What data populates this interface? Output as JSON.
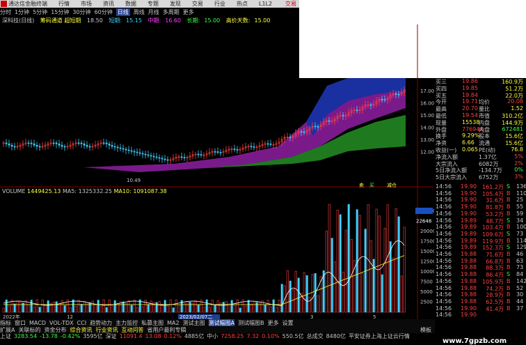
{
  "titlebar": {
    "app": "通达信金融终端",
    "menus": [
      "行情",
      "市场",
      "资讯",
      "数据",
      "专题",
      "发现",
      "交易",
      "行业",
      "热点",
      "L1L2"
    ],
    "right": "交易"
  },
  "periods": [
    "分时",
    "1分钟",
    "5分钟",
    "15分钟",
    "30分钟",
    "60分钟",
    "日线",
    "周线",
    "月线",
    "多周期",
    "更多"
  ],
  "selected_period": "日线",
  "info": {
    "stock": "深科技(日线)",
    "indicator": "筹码通道 超短期",
    "v1": "18.50",
    "short_label": "短期:",
    "short": "15.15",
    "mid_label": "中期:",
    "mid": "16.60",
    "long_label": "长期:",
    "long": "15.00",
    "high_label": "高价天数:",
    "high": "15.00"
  },
  "price_axis": [
    "17.00",
    "16.00",
    "15.00",
    "14.00",
    "13.00",
    "12.00"
  ],
  "low_label": "10.49",
  "vol_info": {
    "label": "VOLUME",
    "vol": "1449425.13",
    "ma5": "MA5: 1325332.25",
    "ma10": "MA10: 1091087.38"
  },
  "vol_axis": [
    "25000",
    "22648",
    "20000",
    "17500",
    "15000",
    "12500",
    "10000",
    "7500",
    "5000",
    "2500"
  ],
  "date_labels": [
    "2022年",
    "12",
    "2023/02/07二",
    "3",
    "5"
  ],
  "signal_labels": [
    "卖",
    "买",
    "减仓"
  ],
  "quote": {
    "rows": [
      {
        "lbl": "买三",
        "v1": "19.86",
        "c1": "red",
        "lbl2": "",
        "v2": "160.9万",
        "c2": "yellow"
      },
      {
        "lbl": "买四",
        "v1": "19.85",
        "c1": "red",
        "lbl2": "",
        "v2": "51.2万",
        "c2": "yellow"
      },
      {
        "lbl": "买五",
        "v1": "19.84",
        "c1": "red",
        "lbl2": "",
        "v2": "22.0万",
        "c2": "yellow"
      },
      {
        "lbl": "今开",
        "v1": "19.71",
        "c1": "red",
        "lbl2": "均价",
        "v2": "20.08",
        "c2": "red"
      },
      {
        "lbl": "最高",
        "v1": "20.70",
        "c1": "red",
        "lbl2": "量比",
        "v2": "1.52",
        "c2": "yellow"
      },
      {
        "lbl": "最低",
        "v1": "19.54",
        "c1": "red",
        "lbl2": "市值",
        "v2": "310.2亿",
        "c2": "yellow"
      },
      {
        "lbl": "现量",
        "v1": "15538",
        "c1": "yellow",
        "lbl2": "内盘",
        "v2": "144.9万",
        "c2": "yellow"
      },
      {
        "lbl": "外盘",
        "v1": "776944",
        "c1": "red",
        "lbl2": "内盘",
        "v2": "672481",
        "c2": "green"
      },
      {
        "lbl": "换手",
        "v1": "9.29%",
        "c1": "yellow",
        "lbl2": "股本",
        "v2": "15.6亿",
        "c2": "yellow"
      },
      {
        "lbl": "净资",
        "v1": "6.66",
        "c1": "yellow",
        "lbl2": "流通",
        "v2": "15.6亿",
        "c2": "yellow"
      },
      {
        "lbl": "收益(一)",
        "v1": "0.065",
        "c1": "yellow",
        "lbl2": "PE(动)",
        "v2": "76.8",
        "c2": "yellow"
      },
      {
        "lbl": "净流入额",
        "v1": "",
        "c1": "red",
        "lbl2": "1.37亿",
        "v2": "5%",
        "c2": "red"
      },
      {
        "lbl": "大宗流入",
        "v1": "",
        "c1": "red",
        "lbl2": "6082万",
        "v2": "2%",
        "c2": "red"
      },
      {
        "lbl": "5日净流入额",
        "v1": "",
        "c1": "red",
        "lbl2": "-134.7万",
        "v2": "0%",
        "c2": "green"
      },
      {
        "lbl": "5日大宗流入",
        "v1": "",
        "c1": "red",
        "lbl2": "6752万",
        "v2": "3%",
        "c2": "red"
      }
    ]
  },
  "trades": [
    {
      "t": "14:56",
      "p": "19.90",
      "v": "161.2万",
      "s": "S",
      "n": "136",
      "sc": "green"
    },
    {
      "t": "14:56",
      "p": "19.90",
      "v": "105.4万",
      "s": "B",
      "n": "110",
      "sc": "red"
    },
    {
      "t": "14:56",
      "p": "19.90",
      "v": "31.6万",
      "s": "B",
      "n": "25",
      "sc": "red"
    },
    {
      "t": "14:56",
      "p": "19.90",
      "v": "81.8万",
      "s": "B",
      "n": "55",
      "sc": "red"
    },
    {
      "t": "14:56",
      "p": "19.90",
      "v": "53.2万",
      "s": "B",
      "n": "59",
      "sc": "red"
    },
    {
      "t": "14:56",
      "p": "19.89",
      "v": "48.7万",
      "s": "S",
      "n": "34",
      "sc": "green"
    },
    {
      "t": "14:56",
      "p": "19.89",
      "v": "103.4万",
      "s": "B",
      "n": "100",
      "sc": "red"
    },
    {
      "t": "14:56",
      "p": "19.89",
      "v": "109.6万",
      "s": "S",
      "n": "73",
      "sc": "green"
    },
    {
      "t": "14:56",
      "p": "19.89",
      "v": "119.9万",
      "s": "B",
      "n": "114",
      "sc": "red"
    },
    {
      "t": "14:56",
      "p": "19.89",
      "v": "152.3万",
      "s": "S",
      "n": "129",
      "sc": "green"
    },
    {
      "t": "14:56",
      "p": "19.88",
      "v": "71.6万",
      "s": "B",
      "n": "46",
      "sc": "red"
    },
    {
      "t": "14:56",
      "p": "19.88",
      "v": "66.8万",
      "s": "B",
      "n": "63",
      "sc": "red"
    },
    {
      "t": "14:56",
      "p": "19.88",
      "v": "88.3万",
      "s": "B",
      "n": "73",
      "sc": "red"
    },
    {
      "t": "14:56",
      "p": "19.88",
      "v": "86.4万",
      "s": "S",
      "n": "84",
      "sc": "green"
    },
    {
      "t": "14:56",
      "p": "19.88",
      "v": "105.9万",
      "s": "B",
      "n": "142",
      "sc": "red"
    },
    {
      "t": "14:56",
      "p": "19.88",
      "v": "74.2万",
      "s": "B",
      "n": "52",
      "sc": "red"
    },
    {
      "t": "14:56",
      "p": "19.88",
      "v": "28.9万",
      "s": "B",
      "n": "30",
      "sc": "red"
    },
    {
      "t": "14:56",
      "p": "19.88",
      "v": "62.5万",
      "s": "B",
      "n": "44",
      "sc": "red"
    },
    {
      "t": "14:56",
      "p": "19.90",
      "v": "41.4万",
      "s": "B",
      "n": "37",
      "sc": "red"
    },
    {
      "t": "14:56",
      "p": "19.90",
      "v": "",
      "s": "",
      "n": "",
      "sc": "red"
    }
  ],
  "tabs1": [
    "指标",
    "窗口",
    "MACD",
    "VOL-TDX",
    "CCI",
    "趋势动力",
    "主力监控",
    "私募主图",
    "MA2",
    "测试主图",
    "测试幅图A",
    "测试幅图B",
    "更多",
    "设置"
  ],
  "tabs2": [
    "扩展A",
    "关联标的",
    "资金分布",
    "综合资讯",
    "行业资讯",
    "互动问答",
    "省用户最利专辑"
  ],
  "tabs2_right": "模板",
  "status": [
    {
      "text": "上证",
      "c": ""
    },
    {
      "text": "3283.54",
      "c": "green"
    },
    {
      "text": "-13.78",
      "c": "green"
    },
    {
      "text": "-0.42%",
      "c": "green"
    },
    {
      "text": "3595亿",
      "c": ""
    },
    {
      "text": "深证",
      "c": ""
    },
    {
      "text": "11091.4",
      "c": "red"
    },
    {
      "text": "13.08",
      "c": "red"
    },
    {
      "text": "0.12%",
      "c": "red"
    },
    {
      "text": "4885亿",
      "c": ""
    },
    {
      "text": "中小",
      "c": ""
    },
    {
      "text": "7258.25",
      "c": "red"
    },
    {
      "text": "7.32",
      "c": "red"
    },
    {
      "text": "0.10%",
      "c": "red"
    },
    {
      "text": "550.5亿",
      "c": ""
    },
    {
      "text": "总成交",
      "c": ""
    },
    {
      "text": "8480亿",
      "c": ""
    },
    {
      "text": "平安证券上海上证云行情",
      "c": ""
    }
  ],
  "watermark": "www.7gpzb.com",
  "colors": {
    "up": "#ff4040",
    "down": "#40d0ff",
    "band_purple": "#7a1a8a",
    "band_green": "#1f7a1f",
    "band_blue": "#1a2fa0"
  }
}
